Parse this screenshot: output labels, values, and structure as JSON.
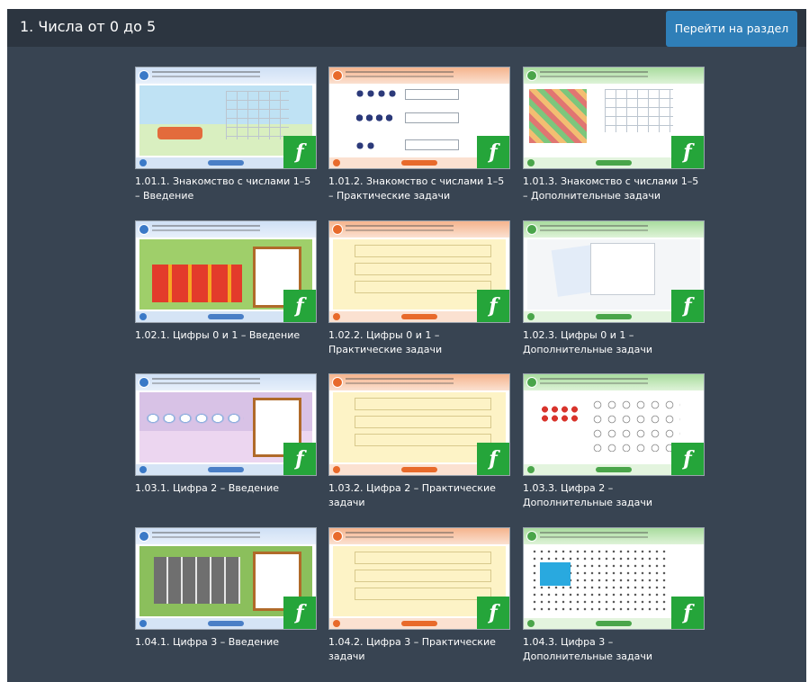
{
  "header": {
    "title": "1. Числа от 0 до 5",
    "goto_label": "Перейти на раздел"
  },
  "cards": [
    {
      "caption": "1.01.1. Знакомство с числами 1–5 – Введение",
      "theme": "blue",
      "icon": "flash-icon"
    },
    {
      "caption": "1.01.2. Знакомство с числами 1–5 – Практические задачи",
      "theme": "orange",
      "icon": "flash-icon"
    },
    {
      "caption": "1.01.3. Знакомство с числами 1–5 – Дополнительные задачи",
      "theme": "green",
      "icon": "flash-icon"
    },
    {
      "caption": "1.02.1. Цифры 0 и 1 – Введение",
      "theme": "blue",
      "icon": "flash-icon"
    },
    {
      "caption": "1.02.2. Цифры 0 и 1 – Практические задачи",
      "theme": "orange",
      "icon": "flash-icon"
    },
    {
      "caption": "1.02.3. Цифры 0 и 1 – Дополнительные задачи",
      "theme": "green",
      "icon": "flash-icon"
    },
    {
      "caption": "1.03.1. Цифра 2 – Введение",
      "theme": "blue",
      "icon": "flash-icon"
    },
    {
      "caption": "1.03.2. Цифра 2 – Практические задачи",
      "theme": "orange",
      "icon": "flash-icon"
    },
    {
      "caption": "1.03.3. Цифра 2 – Дополнительные задачи",
      "theme": "green",
      "icon": "flash-icon"
    },
    {
      "caption": "1.04.1. Цифра 3 – Введение",
      "theme": "blue",
      "icon": "flash-icon"
    },
    {
      "caption": "1.04.2. Цифра 3 – Практические задачи",
      "theme": "orange",
      "icon": "flash-icon"
    },
    {
      "caption": "1.04.3. Цифра 3 – Дополнительные задачи",
      "theme": "green",
      "icon": "flash-icon"
    }
  ],
  "colors": {
    "panel_bg": "#384452",
    "header_bg": "#2c3540",
    "button_bg": "#2f7fb8",
    "flash_badge": "#25a53a"
  }
}
